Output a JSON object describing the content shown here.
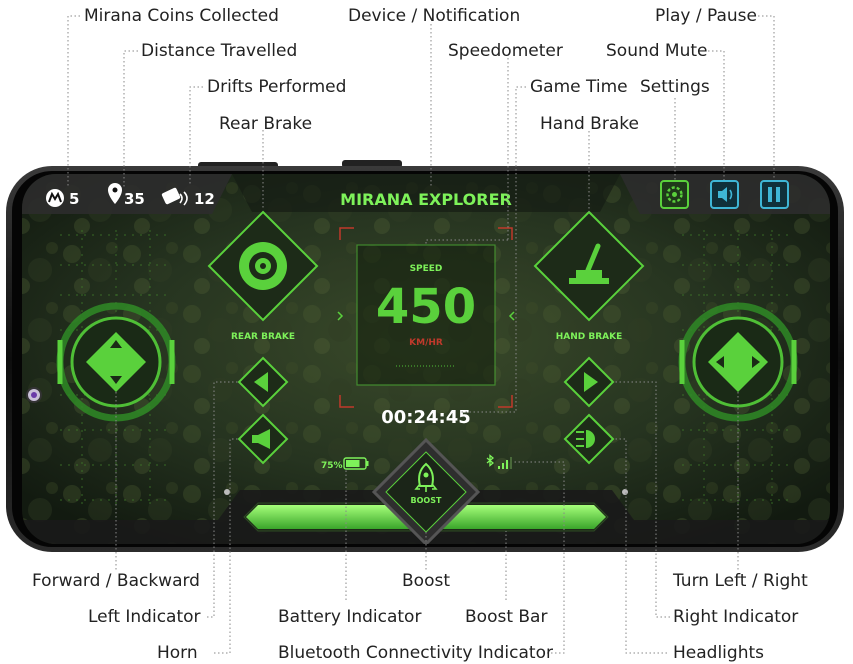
{
  "callouts": {
    "mirana_coins": "Mirana Coins Collected",
    "distance": "Distance Travelled",
    "drifts": "Drifts Performed",
    "rear_brake": "Rear Brake",
    "device_notification": "Device / Notification",
    "speedometer": "Speedometer",
    "game_time": "Game Time",
    "settings": "Settings",
    "hand_brake": "Hand Brake",
    "sound_mute": "Sound Mute",
    "play_pause": "Play / Pause",
    "forward_backward": "Forward / Backward",
    "left_indicator": "Left Indicator",
    "horn": "Horn",
    "boost": "Boost",
    "battery_indicator": "Battery Indicator",
    "boost_bar": "Boost Bar",
    "bluetooth_indicator": "Bluetooth Connectivity Indicator",
    "turn_left_right": "Turn Left / Right",
    "right_indicator": "Right Indicator",
    "headlights": "Headlights"
  },
  "hud": {
    "title": "MIRANA EXPLORER",
    "coins": "5",
    "distance": "35",
    "drifts": "12",
    "speed_label": "SPEED",
    "speed_value": "450",
    "speed_unit": "KM/HR",
    "game_time": "00:24:45",
    "rear_brake_label": "REAR BRAKE",
    "hand_brake_label": "HAND BRAKE",
    "battery": "75%",
    "battery_level": 0.75,
    "boost_label": "BOOST",
    "boost_level_left": 1.0,
    "boost_level_right": 1.0
  },
  "colors": {
    "accent_green": "#5ad13c",
    "bright_green": "#7ef25a",
    "cyan": "#3fb6d6",
    "bg_dark": "#1c2a1a"
  }
}
